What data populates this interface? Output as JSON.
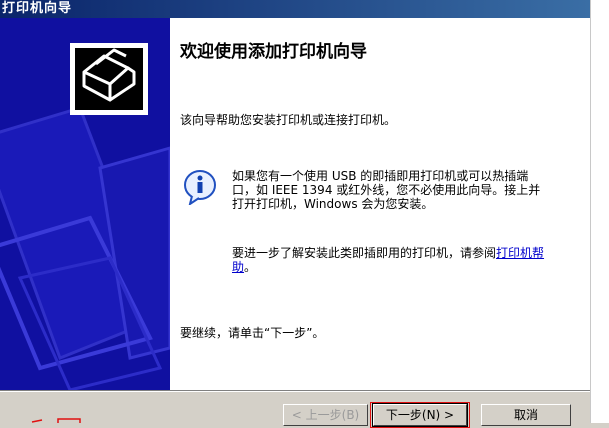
{
  "window": {
    "title": "打印机向导"
  },
  "heading": "欢迎使用添加打印机向导",
  "intro": "该向导帮助您安装打印机或连接打印机。",
  "info": {
    "text": "如果您有一个使用 USB 的即插即用打印机或可以热插端口，如 IEEE 1394 或红外线，您不必使用此向导。接上并打开打印机，Windows 会为您安装。",
    "more_prefix": "要进一步了解安装此类即插即用的打印机，请参阅",
    "help_link": "打印机帮助",
    "more_suffix": "。"
  },
  "continue_text": "要继续，请单击“下一步”。",
  "buttons": {
    "back": "< 上一步(B)",
    "next": "下一步(N) >",
    "cancel": "取消"
  },
  "colors": {
    "banner": "#1010a0",
    "titlebar": "#0a246a",
    "link": "#0000cc"
  }
}
